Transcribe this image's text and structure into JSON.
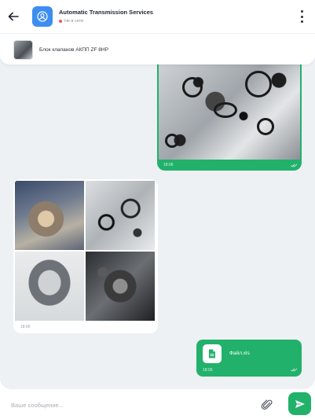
{
  "header": {
    "title": "Automatic Transmission Services",
    "status": "Не в сети",
    "status_color": "#f0556a",
    "avatar_color": "#3d8ef0",
    "back_icon": "arrow-left-icon",
    "menu_icon": "more-vertical-icon"
  },
  "product": {
    "name": "Блок клапанов АКПП ZF 8HP"
  },
  "messages": [
    {
      "type": "photo",
      "direction": "outgoing",
      "time": "18:06",
      "read": true
    },
    {
      "type": "photo-grid",
      "direction": "incoming",
      "time": "18:06",
      "count": 4
    },
    {
      "type": "file",
      "direction": "outgoing",
      "file_name": "Файл.xls",
      "time": "18:06",
      "read": true
    }
  ],
  "composer": {
    "placeholder": "Ваше сообщение...",
    "attach_icon": "paperclip-icon",
    "send_icon": "send-icon"
  },
  "colors": {
    "accent": "#22b16b",
    "chat_background": "#eef1f3"
  }
}
